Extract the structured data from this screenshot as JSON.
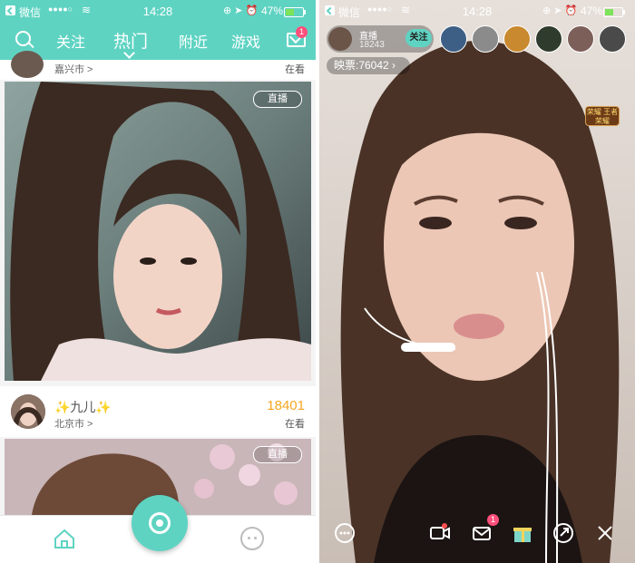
{
  "status_bar": {
    "carrier": "微信",
    "signal": "●●●●○",
    "wifi_icon": "wifi-icon",
    "time": "14:28",
    "icons": "⊕ ➤ ⏰",
    "battery_pct": "47%",
    "battery_level": 0.47
  },
  "home": {
    "tabs": [
      {
        "label": "关注",
        "active": false
      },
      {
        "label": "热门",
        "active": true
      },
      {
        "label": "附近",
        "active": false
      },
      {
        "label": "游戏",
        "active": false
      }
    ],
    "mail_badge": "1",
    "feed": [
      {
        "location": "嘉兴市",
        "watch_label": "在看",
        "live_tag": "直播"
      },
      {
        "name": "✨九儿✨",
        "viewers": "18401",
        "location": "北京市",
        "watch_label": "在看",
        "live_tag": "直播"
      }
    ]
  },
  "stream": {
    "host_status": "直播",
    "host_count": "18243",
    "follow_label": "关注",
    "tickets": "映票:76042",
    "event_badge": "荣耀 王者荣耀",
    "message_badge": "1"
  },
  "colors": {
    "accent": "#5fd3c2",
    "viewer_count": "#f5a623",
    "badge": "#ff4f7b"
  }
}
